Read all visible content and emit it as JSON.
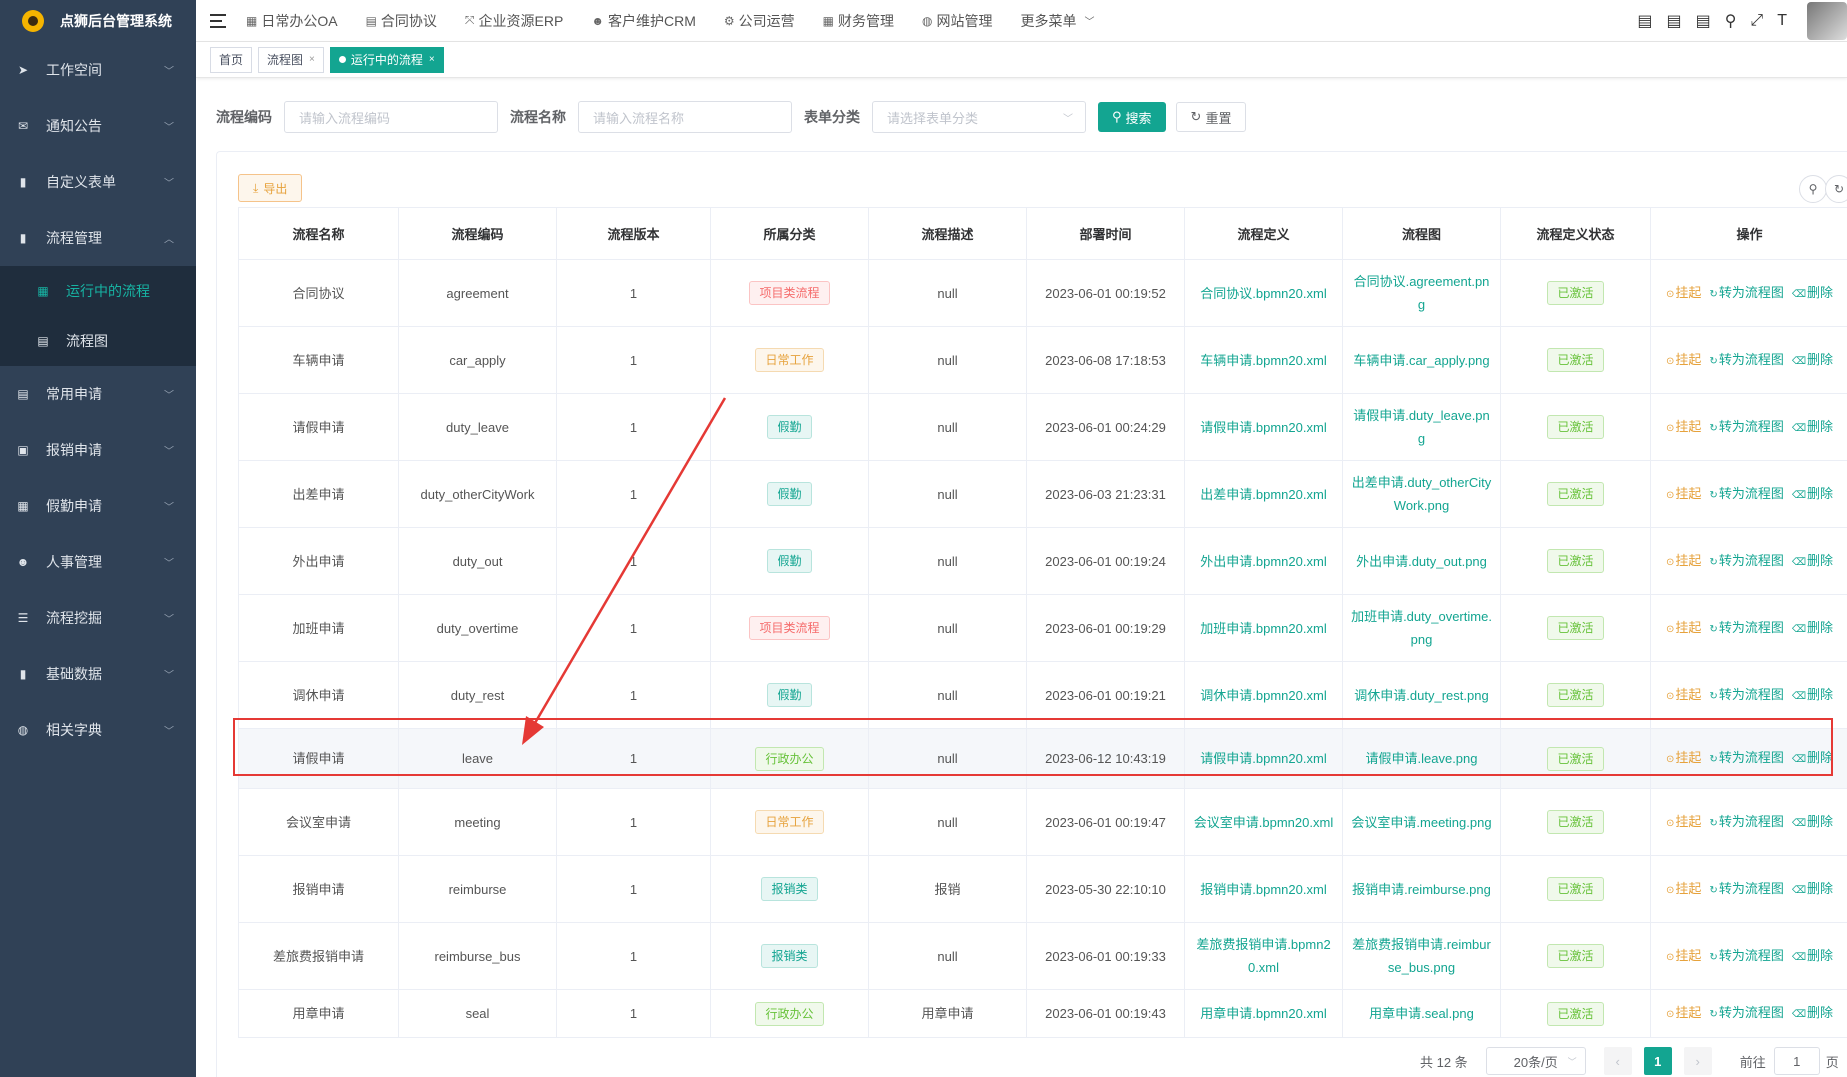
{
  "app": {
    "title": "点狮后台管理系统"
  },
  "sidebar": {
    "items": [
      {
        "label": "工作空间",
        "icon": "send-icon"
      },
      {
        "label": "通知公告",
        "icon": "mail-icon"
      },
      {
        "label": "自定义表单",
        "icon": "form-icon"
      },
      {
        "label": "流程管理",
        "icon": "chart-icon",
        "expanded": true
      }
    ],
    "subitems": [
      {
        "label": "运行中的流程",
        "icon": "grid-icon",
        "active": true
      },
      {
        "label": "流程图",
        "icon": "document-icon"
      }
    ],
    "items_after": [
      {
        "label": "常用申请",
        "icon": "document-icon"
      },
      {
        "label": "报销申请",
        "icon": "receipt-icon"
      },
      {
        "label": "假勤申请",
        "icon": "calendar-icon"
      },
      {
        "label": "人事管理",
        "icon": "user-icon"
      },
      {
        "label": "流程挖掘",
        "icon": "list-icon"
      },
      {
        "label": "基础数据",
        "icon": "chart-icon"
      },
      {
        "label": "相关字典",
        "icon": "globe-icon"
      }
    ]
  },
  "topnav": {
    "items": [
      {
        "label": "日常办公OA",
        "icon": "calendar-icon"
      },
      {
        "label": "合同协议",
        "icon": "document-icon"
      },
      {
        "label": "企业资源ERP",
        "icon": "expand-icon"
      },
      {
        "label": "客户维护CRM",
        "icon": "users-icon"
      },
      {
        "label": "公司运营",
        "icon": "settings-icon"
      },
      {
        "label": "财务管理",
        "icon": "table-icon"
      },
      {
        "label": "网站管理",
        "icon": "globe-icon"
      },
      {
        "label": "更多菜单",
        "icon": "chevron-down-icon"
      }
    ]
  },
  "tags": [
    {
      "label": "首页",
      "closable": false,
      "active": false
    },
    {
      "label": "流程图",
      "closable": true,
      "active": false
    },
    {
      "label": "运行中的流程",
      "closable": true,
      "active": true
    }
  ],
  "search": {
    "code_label": "流程编码",
    "code_placeholder": "请输入流程编码",
    "name_label": "流程名称",
    "name_placeholder": "请输入流程名称",
    "category_label": "表单分类",
    "category_placeholder": "请选择表单分类",
    "search_btn": "搜索",
    "reset_btn": "重置"
  },
  "toolbar": {
    "export_btn": "导出"
  },
  "table": {
    "headers": [
      "流程名称",
      "流程编码",
      "流程版本",
      "所属分类",
      "流程描述",
      "部署时间",
      "流程定义",
      "流程图",
      "流程定义状态",
      "操作"
    ],
    "ops": [
      "挂起",
      "转为流程图",
      "删除"
    ],
    "rows": [
      {
        "name": "合同协议",
        "code": "agreement",
        "version": "1",
        "category": "项目类流程",
        "cat_color": "red",
        "desc": "null",
        "time": "2023-06-01 00:19:52",
        "def": "合同协议.bpmn20.xml",
        "img": "合同协议.agreement.png",
        "status": "已激活"
      },
      {
        "name": "车辆申请",
        "code": "car_apply",
        "version": "1",
        "category": "日常工作",
        "cat_color": "orange",
        "desc": "null",
        "time": "2023-06-08 17:18:53",
        "def": "车辆申请.bpmn20.xml",
        "img": "车辆申请.car_apply.png",
        "status": "已激活"
      },
      {
        "name": "请假申请",
        "code": "duty_leave",
        "version": "1",
        "category": "假勤",
        "cat_color": "green",
        "desc": "null",
        "time": "2023-06-01 00:24:29",
        "def": "请假申请.bpmn20.xml",
        "img": "请假申请.duty_leave.png",
        "status": "已激活"
      },
      {
        "name": "出差申请",
        "code": "duty_otherCityWork",
        "version": "1",
        "category": "假勤",
        "cat_color": "green",
        "desc": "null",
        "time": "2023-06-03 21:23:31",
        "def": "出差申请.bpmn20.xml",
        "img": "出差申请.duty_otherCityWork.png",
        "status": "已激活"
      },
      {
        "name": "外出申请",
        "code": "duty_out",
        "version": "1",
        "category": "假勤",
        "cat_color": "green",
        "desc": "null",
        "time": "2023-06-01 00:19:24",
        "def": "外出申请.bpmn20.xml",
        "img": "外出申请.duty_out.png",
        "status": "已激活"
      },
      {
        "name": "加班申请",
        "code": "duty_overtime",
        "version": "1",
        "category": "项目类流程",
        "cat_color": "red",
        "desc": "null",
        "time": "2023-06-01 00:19:29",
        "def": "加班申请.bpmn20.xml",
        "img": "加班申请.duty_overtime.png",
        "status": "已激活"
      },
      {
        "name": "调休申请",
        "code": "duty_rest",
        "version": "1",
        "category": "假勤",
        "cat_color": "green",
        "desc": "null",
        "time": "2023-06-01 00:19:21",
        "def": "调休申请.bpmn20.xml",
        "img": "调休申请.duty_rest.png",
        "status": "已激活"
      },
      {
        "name": "请假申请",
        "code": "leave",
        "version": "1",
        "category": "行政办公",
        "cat_color": "lime",
        "desc": "null",
        "time": "2023-06-12 10:43:19",
        "def": "请假申请.bpmn20.xml",
        "img": "请假申请.leave.png",
        "status": "已激活",
        "highlight": true
      },
      {
        "name": "会议室申请",
        "code": "meeting",
        "version": "1",
        "category": "日常工作",
        "cat_color": "orange",
        "desc": "null",
        "time": "2023-06-01 00:19:47",
        "def": "会议室申请.bpmn20.xml",
        "img": "会议室申请.meeting.png",
        "status": "已激活"
      },
      {
        "name": "报销申请",
        "code": "reimburse",
        "version": "1",
        "category": "报销类",
        "cat_color": "green",
        "desc": "报销",
        "time": "2023-05-30 22:10:10",
        "def": "报销申请.bpmn20.xml",
        "img": "报销申请.reimburse.png",
        "status": "已激活"
      },
      {
        "name": "差旅费报销申请",
        "code": "reimburse_bus",
        "version": "1",
        "category": "报销类",
        "cat_color": "green",
        "desc": "null",
        "time": "2023-06-01 00:19:33",
        "def": "差旅费报销申请.bpmn20.xml",
        "img": "差旅费报销申请.reimburse_bus.png",
        "status": "已激活"
      },
      {
        "name": "用章申请",
        "code": "seal",
        "version": "1",
        "category": "行政办公",
        "cat_color": "lime",
        "desc": "用章申请",
        "time": "2023-06-01 00:19:43",
        "def": "用章申请.bpmn20.xml",
        "img": "用章申请.seal.png",
        "status": "已激活",
        "short": true
      }
    ]
  },
  "pagination": {
    "total": "共 12 条",
    "page_size": "20条/页",
    "current": "1",
    "goto_label": "前往",
    "goto_value": "1",
    "page_suffix": "页"
  },
  "colors": {
    "sidebar_bg": "#304156",
    "accent": "#13a591",
    "highlight_border": "#e53935"
  }
}
